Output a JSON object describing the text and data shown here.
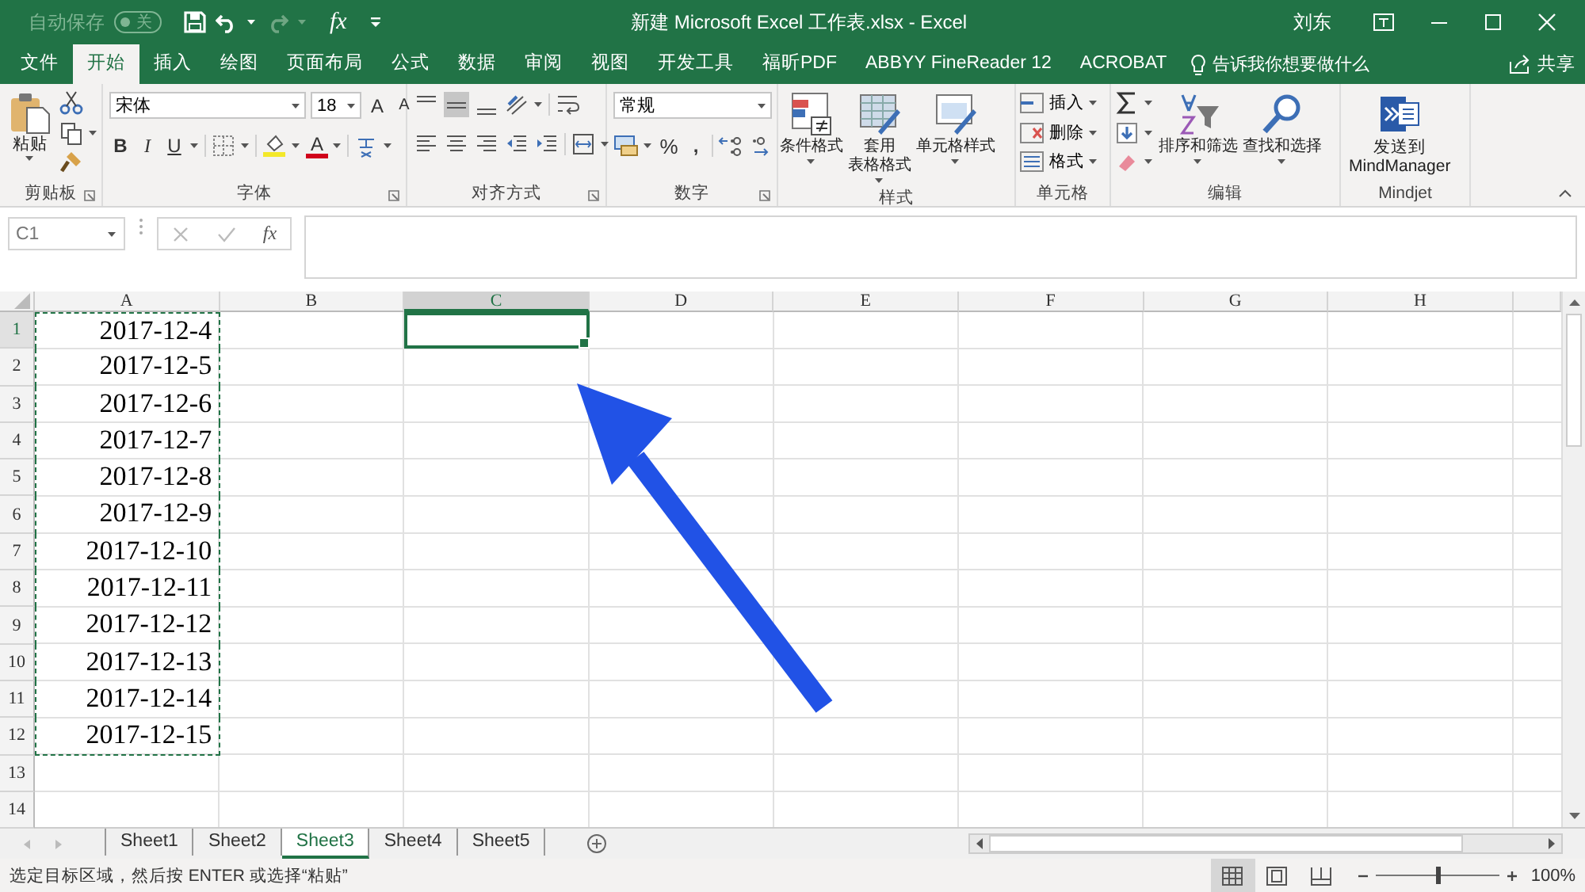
{
  "quick_access": {
    "autosave_label": "自动保存",
    "autosave": {
      "on": false,
      "label": "关"
    },
    "formula_glyph": "fx"
  },
  "window": {
    "title": "新建 Microsoft Excel 工作表.xlsx  -  Excel",
    "user": "刘东"
  },
  "tabs": [
    {
      "label": "文件",
      "selected": false
    },
    {
      "label": "开始",
      "selected": true
    },
    {
      "label": "插入",
      "selected": false
    },
    {
      "label": "绘图",
      "selected": false
    },
    {
      "label": "页面布局",
      "selected": false
    },
    {
      "label": "公式",
      "selected": false
    },
    {
      "label": "数据",
      "selected": false
    },
    {
      "label": "审阅",
      "selected": false
    },
    {
      "label": "视图",
      "selected": false
    },
    {
      "label": "开发工具",
      "selected": false
    },
    {
      "label": "福昕PDF",
      "selected": false
    },
    {
      "label": "ABBYY FineReader 12",
      "selected": false
    },
    {
      "label": "ACROBAT",
      "selected": false
    }
  ],
  "tell_me": "告诉我你想要做什么",
  "share": "共享",
  "ribbon": {
    "groups": [
      {
        "kind": "clipboard",
        "title": "剪贴板",
        "paste": "粘贴"
      },
      {
        "kind": "font",
        "title": "字体",
        "font_name": "宋体",
        "font_size": "18",
        "grow": "A",
        "shrink": "A",
        "bold": "B",
        "italic": "I",
        "underline": "U",
        "font_color": "A"
      },
      {
        "kind": "alignment",
        "title": "对齐方式"
      },
      {
        "kind": "number",
        "title": "数字",
        "format": "常规",
        "percent": "%",
        "comma": ","
      },
      {
        "kind": "styles",
        "title": "样式",
        "buttons": [
          {
            "lines": [
              "条件格式"
            ]
          },
          {
            "lines": [
              "套用",
              "表格格式"
            ]
          },
          {
            "lines": [
              "单元格样式"
            ]
          }
        ]
      },
      {
        "kind": "cells",
        "title": "单元格",
        "buttons": [
          "插入",
          "删除",
          "格式"
        ]
      },
      {
        "kind": "editing",
        "title": "编辑",
        "buttons": [
          "排序和筛选",
          "查找和选择"
        ]
      },
      {
        "kind": "addin",
        "title": "Mindjet",
        "lines": [
          "发送到",
          "MindManager"
        ]
      }
    ]
  },
  "formula_bar": {
    "name_box": "C1",
    "fx": "fx"
  },
  "grid": {
    "columns": [
      {
        "label": "A",
        "selected": false,
        "copied": true
      },
      {
        "label": "B",
        "selected": false,
        "copied": false
      },
      {
        "label": "C",
        "selected": true,
        "copied": false
      },
      {
        "label": "D",
        "selected": false,
        "copied": false
      },
      {
        "label": "E",
        "selected": false,
        "copied": false
      },
      {
        "label": "F",
        "selected": false,
        "copied": false
      },
      {
        "label": "G",
        "selected": false,
        "copied": false
      },
      {
        "label": "H",
        "selected": false,
        "copied": false
      }
    ],
    "rows": [
      {
        "label": "1",
        "selected": true,
        "copied": true,
        "cells": [
          "2017-12-4"
        ]
      },
      {
        "label": "2",
        "selected": false,
        "copied": true,
        "cells": [
          "2017-12-5"
        ]
      },
      {
        "label": "3",
        "selected": false,
        "copied": true,
        "cells": [
          "2017-12-6"
        ]
      },
      {
        "label": "4",
        "selected": false,
        "copied": true,
        "cells": [
          "2017-12-7"
        ]
      },
      {
        "label": "5",
        "selected": false,
        "copied": true,
        "cells": [
          "2017-12-8"
        ]
      },
      {
        "label": "6",
        "selected": false,
        "copied": true,
        "cells": [
          "2017-12-9"
        ]
      },
      {
        "label": "7",
        "selected": false,
        "copied": true,
        "cells": [
          "2017-12-10"
        ]
      },
      {
        "label": "8",
        "selected": false,
        "copied": true,
        "cells": [
          "2017-12-11"
        ]
      },
      {
        "label": "9",
        "selected": false,
        "copied": true,
        "cells": [
          "2017-12-12"
        ]
      },
      {
        "label": "10",
        "selected": false,
        "copied": true,
        "cells": [
          "2017-12-13"
        ]
      },
      {
        "label": "11",
        "selected": false,
        "copied": true,
        "cells": [
          "2017-12-14"
        ]
      },
      {
        "label": "12",
        "selected": false,
        "copied": true,
        "cells": [
          "2017-12-15"
        ]
      },
      {
        "label": "13",
        "selected": false,
        "copied": false,
        "cells": []
      },
      {
        "label": "14",
        "selected": false,
        "copied": false,
        "cells": []
      }
    ]
  },
  "sheets": [
    {
      "label": "Sheet1",
      "selected": false
    },
    {
      "label": "Sheet2",
      "selected": false
    },
    {
      "label": "Sheet3",
      "selected": true
    },
    {
      "label": "Sheet4",
      "selected": false
    },
    {
      "label": "Sheet5",
      "selected": false
    }
  ],
  "status_bar": {
    "message": "选定目标区域，然后按 ENTER 或选择“粘贴”",
    "views": [
      {
        "kind": "normal",
        "selected": true
      },
      {
        "kind": "page_layout",
        "selected": false
      },
      {
        "kind": "page_break",
        "selected": false
      }
    ],
    "zoom": {
      "level": 0.5,
      "reading": "100%"
    }
  }
}
